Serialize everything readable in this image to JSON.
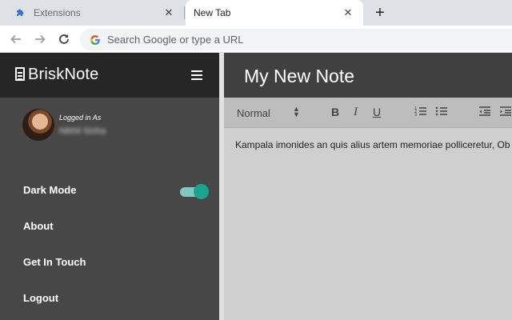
{
  "browser": {
    "tabs": [
      {
        "title": "Extensions",
        "active": false,
        "icon": "puzzle-icon"
      },
      {
        "title": "New Tab",
        "active": true,
        "icon": "none"
      }
    ],
    "new_tab_symbol": "+",
    "close_symbol": "✕",
    "omnibox_placeholder": "Search Google or type a URL"
  },
  "app": {
    "brand": "BriskNote",
    "profile": {
      "logged_in_label": "Logged in As",
      "username": "Nikhil Sinha"
    },
    "menu": [
      {
        "label": "Dark Mode",
        "type": "toggle",
        "checked": true
      },
      {
        "label": "About"
      },
      {
        "label": "Get In Touch"
      },
      {
        "label": "Logout"
      }
    ],
    "note": {
      "title": "My New Note",
      "format": "Normal",
      "content": "Kampala imonides an quis alius artem memoriae polliceretur, Ob"
    },
    "toolbar_buttons": [
      "B",
      "I",
      "U"
    ],
    "colors": {
      "sidebar": "#474747",
      "sidebar_header": "#262626",
      "note_header": "#404040",
      "editor_bg": "#cfcfcf",
      "toggle_accent": "#1aa38f"
    }
  }
}
